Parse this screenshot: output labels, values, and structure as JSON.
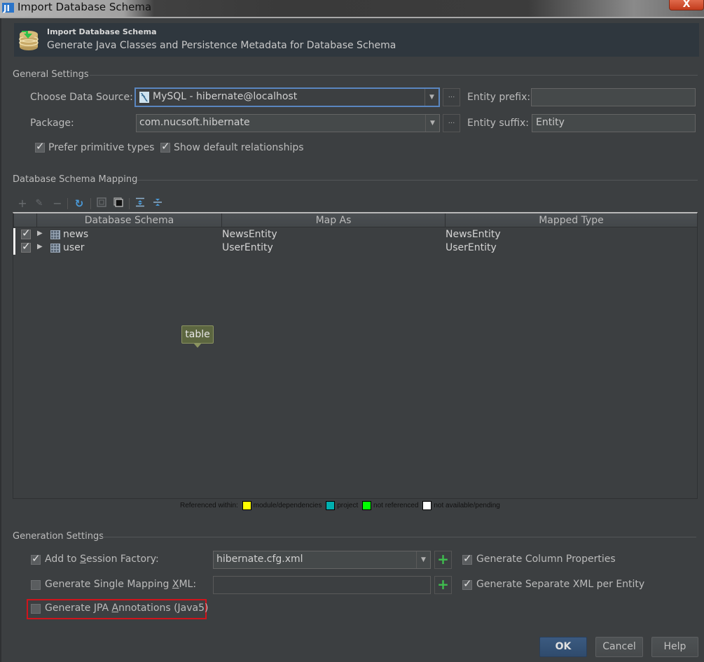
{
  "window": {
    "title": "Import Database Schema",
    "close_label": "X"
  },
  "banner": {
    "title": "Import Database Schema",
    "subtitle": "Generate Java Classes and Persistence Metadata for Database Schema",
    "icon": "database-import-icon"
  },
  "general_settings": {
    "section_title": "General Settings",
    "data_source_label": "Choose Data Source:",
    "data_source_value": "MySQL - hibernate@localhost",
    "data_source_icon": "mysql-icon",
    "package_label": "Package:",
    "package_value": "com.nucsoft.hibernate",
    "browse_label": "...",
    "entity_prefix_label": "Entity prefix:",
    "entity_prefix_value": "",
    "entity_suffix_label": "Entity suffix:",
    "entity_suffix_value": "Entity",
    "prefer_primitive_label": "Prefer primitive types",
    "prefer_primitive_checked": true,
    "show_relationships_label": "Show default relationships",
    "show_relationships_checked": true
  },
  "schema_mapping": {
    "section_title": "Database Schema Mapping",
    "toolbar": [
      "add-icon",
      "edit-icon",
      "remove-icon",
      "refresh-icon",
      "unselect-all-icon",
      "select-all-icon",
      "expand-all-icon",
      "collapse-all-icon"
    ],
    "columns": [
      "Database Schema",
      "Map As",
      "Mapped Type"
    ],
    "rows": [
      {
        "checked": true,
        "name": "news",
        "map_as": "NewsEntity",
        "mapped_type": "NewsEntity"
      },
      {
        "checked": true,
        "name": "user",
        "map_as": "UserEntity",
        "mapped_type": "UserEntity"
      }
    ],
    "tooltip": "table"
  },
  "legend": {
    "prefix": "Referenced within:",
    "items": [
      {
        "label": "module/dependencies",
        "color": "#ffff00"
      },
      {
        "label": "project",
        "color": "#00b0b0"
      },
      {
        "label": "not referenced",
        "color": "#00ff00"
      },
      {
        "label": "not available/pending",
        "color": "#ffffff"
      }
    ]
  },
  "generation_settings": {
    "section_title": "Generation Settings",
    "session_factory_label_pre": "Add to ",
    "session_factory_label_u": "S",
    "session_factory_label_post": "ession Factory:",
    "session_factory_checked": true,
    "session_factory_value": "hibernate.cfg.xml",
    "single_mapping_label_pre": "Generate Single Mapping ",
    "single_mapping_label_u": "X",
    "single_mapping_label_post": "ML:",
    "single_mapping_checked": false,
    "single_mapping_value": "",
    "jpa_label_pre": "Generate JPA ",
    "jpa_label_u": "A",
    "jpa_label_post": "nnotations (Java5)",
    "jpa_checked": false,
    "column_props_label": "Generate Column Properties",
    "column_props_checked": true,
    "separate_xml_label": "Generate Separate XML per Entity",
    "separate_xml_checked": true,
    "add_label": "+"
  },
  "buttons": {
    "ok": "OK",
    "cancel": "Cancel",
    "help": "Help"
  },
  "colors": {
    "background": "#3c3f41",
    "focus_border": "#5a86c0",
    "highlight_box": "#d0141c",
    "add_green": "#3fbf4f"
  }
}
